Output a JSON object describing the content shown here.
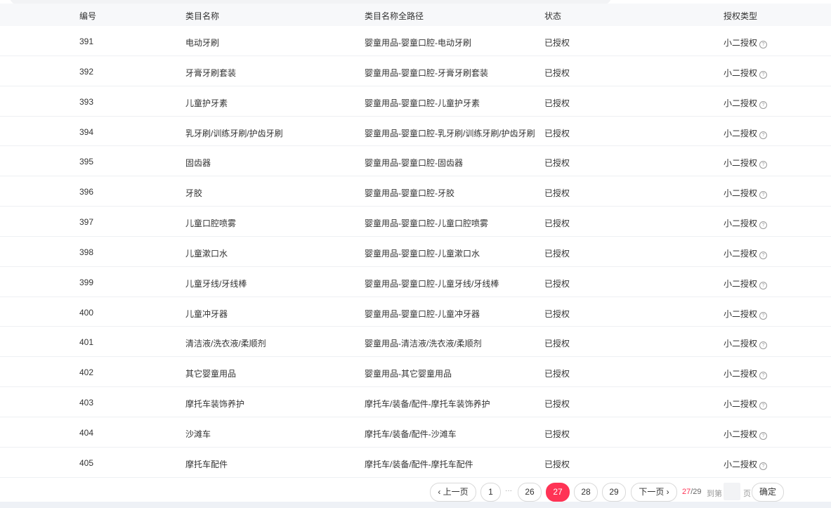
{
  "columns": {
    "id": "编号",
    "name": "类目名称",
    "path": "类目名称全路径",
    "status": "状态",
    "auth": "授权类型"
  },
  "rows": [
    {
      "id": "391",
      "name": "电动牙刷",
      "path": "婴童用品-婴童口腔-电动牙刷",
      "status": "已授权",
      "auth": "小二授权"
    },
    {
      "id": "392",
      "name": "牙膏牙刷套装",
      "path": "婴童用品-婴童口腔-牙膏牙刷套装",
      "status": "已授权",
      "auth": "小二授权"
    },
    {
      "id": "393",
      "name": "儿童护牙素",
      "path": "婴童用品-婴童口腔-儿童护牙素",
      "status": "已授权",
      "auth": "小二授权"
    },
    {
      "id": "394",
      "name": "乳牙刷/训练牙刷/护齿牙刷",
      "path": "婴童用品-婴童口腔-乳牙刷/训练牙刷/护齿牙刷",
      "status": "已授权",
      "auth": "小二授权"
    },
    {
      "id": "395",
      "name": "固齿器",
      "path": "婴童用品-婴童口腔-固齿器",
      "status": "已授权",
      "auth": "小二授权"
    },
    {
      "id": "396",
      "name": "牙胶",
      "path": "婴童用品-婴童口腔-牙胶",
      "status": "已授权",
      "auth": "小二授权"
    },
    {
      "id": "397",
      "name": "儿童口腔喷雾",
      "path": "婴童用品-婴童口腔-儿童口腔喷雾",
      "status": "已授权",
      "auth": "小二授权"
    },
    {
      "id": "398",
      "name": "儿童漱口水",
      "path": "婴童用品-婴童口腔-儿童漱口水",
      "status": "已授权",
      "auth": "小二授权"
    },
    {
      "id": "399",
      "name": "儿童牙线/牙线棒",
      "path": "婴童用品-婴童口腔-儿童牙线/牙线棒",
      "status": "已授权",
      "auth": "小二授权"
    },
    {
      "id": "400",
      "name": "儿童冲牙器",
      "path": "婴童用品-婴童口腔-儿童冲牙器",
      "status": "已授权",
      "auth": "小二授权"
    },
    {
      "id": "401",
      "name": "清洁液/洗衣液/柔顺剂",
      "path": "婴童用品-清洁液/洗衣液/柔顺剂",
      "status": "已授权",
      "auth": "小二授权"
    },
    {
      "id": "402",
      "name": "其它婴童用品",
      "path": "婴童用品-其它婴童用品",
      "status": "已授权",
      "auth": "小二授权"
    },
    {
      "id": "403",
      "name": "摩托车装饰养护",
      "path": "摩托车/装备/配件-摩托车装饰养护",
      "status": "已授权",
      "auth": "小二授权"
    },
    {
      "id": "404",
      "name": "沙滩车",
      "path": "摩托车/装备/配件-沙滩车",
      "status": "已授权",
      "auth": "小二授权"
    },
    {
      "id": "405",
      "name": "摩托车配件",
      "path": "摩托车/装备/配件-摩托车配件",
      "status": "已授权",
      "auth": "小二授权"
    }
  ],
  "pagination": {
    "prev_label": "上一页",
    "next_label": "下一页",
    "pages": [
      "1",
      "26",
      "27",
      "28",
      "29"
    ],
    "ellipsis": "···",
    "current": "27",
    "total": "/29",
    "goto_label": "到第",
    "goto_suffix": "页",
    "confirm_label": "确定"
  },
  "colors": {
    "accent": "#ff3355",
    "header_bg": "#f7f8fa"
  },
  "icons": {
    "help": "?",
    "prev": "‹",
    "next": "›"
  }
}
